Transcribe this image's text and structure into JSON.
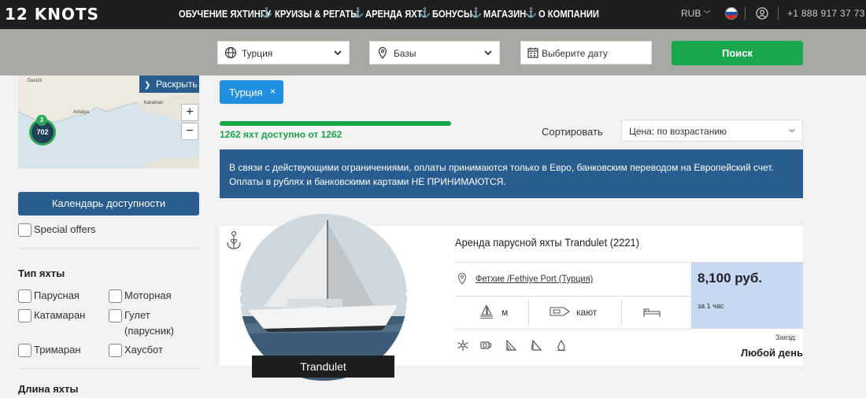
{
  "nav": {
    "logo": "12 KNOTS",
    "items": [
      "ОБУЧЕНИЕ ЯХТИНГУ",
      "КРУИЗЫ & РЕГАТЫ",
      "АРЕНДА ЯХТ",
      "БОНУСЫ",
      "МАГАЗИН",
      "О КОМПАНИИ"
    ],
    "currency": "RUB",
    "phone": "+1 888 917 37 73",
    "flag_colors": [
      "#ffffff",
      "#1f4fb4",
      "#d52b1e"
    ]
  },
  "search": {
    "country": "Турция",
    "bases_placeholder": "Базы",
    "date_placeholder": "Выберите дату",
    "button": "Поиск"
  },
  "map": {
    "expand": "Раскрыть",
    "zoom_in": "+",
    "zoom_out": "−",
    "labels": [
      "Denizli",
      "Antalya",
      "Karaman"
    ],
    "cluster_count": "702",
    "cluster_small": "3"
  },
  "filters": {
    "calendar_button": "Календарь доступности",
    "special_offers": "Special offers",
    "yacht_type_title": "Тип яхты",
    "yacht_types": [
      "Парусная",
      "Моторная",
      "Катамаран",
      "Гулет (парусник)",
      "Тримаран",
      "Хаусбот"
    ],
    "length_title": "Длина яхты"
  },
  "results": {
    "chip": "Турция",
    "chip_close": "×",
    "progress": 1.0,
    "count_text": "1262 яхт доступно от 1262",
    "sort_label": "Сортировать",
    "sort_value": "Цена: по возрастанию",
    "notice": "В связи с действующими ограничениями, оплаты принимаются только в Евро, банковским переводом на Европейский счет. Оплаты в рублях и банковскими картами НЕ ПРИНИМАЮТСЯ."
  },
  "card": {
    "boat_name": "Trandulet",
    "title": "Аренда парусной яхты Trandulet (2221)",
    "location": "Фетхие /Fethiye Port (Турция)",
    "price": "8,100 руб.",
    "price_unit": "за 1 час",
    "length_unit": "м",
    "cabins_label": "кают",
    "checkin_label": "Заезд:",
    "checkin_value": "Любой день"
  },
  "colors": {
    "accent_blue": "#2a5d8f",
    "chip_blue": "#1f8fe0",
    "green": "#18a74a",
    "price_bg": "#c6d8f2"
  }
}
